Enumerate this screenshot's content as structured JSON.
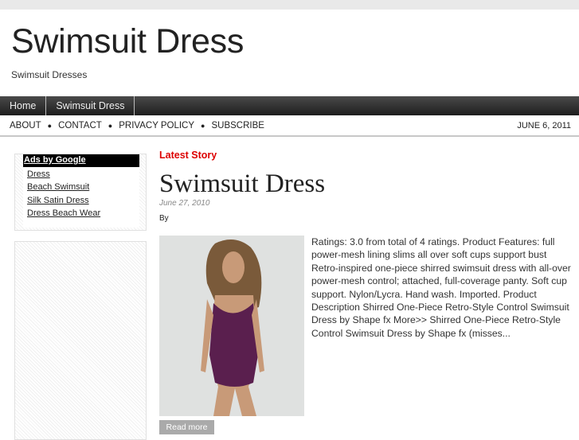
{
  "site": {
    "title": "Swimsuit Dress",
    "description": "Swimsuit Dresses"
  },
  "nav": {
    "items": [
      "Home",
      "Swimsuit Dress"
    ]
  },
  "subnav": {
    "items": [
      "ABOUT",
      "CONTACT",
      "PRIVACY POLICY",
      "SUBSCRIBE"
    ],
    "separator": "●",
    "date": "JUNE 6, 2011"
  },
  "ads": {
    "header": "Ads by Google",
    "links": [
      "Dress",
      "Beach Swimsuit",
      "Silk Satin Dress",
      "Dress Beach Wear"
    ]
  },
  "post": {
    "section": "Latest Story",
    "title": "Swimsuit Dress",
    "date": "June 27, 2010",
    "byline": "By",
    "excerpt": "Ratings: 3.0 from total of 4 ratings. Product Features: full power-mesh lining slims all over soft cups support bust Retro-inspired one-piece shirred swimsuit dress with all-over power-mesh control; attached, full-coverage panty. Soft cup support. Nylon/Lycra. Hand wash. Imported. Product Description Shirred One-Piece Retro-Style Control Swimsuit Dress by Shape fx More>> Shirred One-Piece Retro-Style Control Swimsuit Dress by Shape fx (misses...",
    "read_more": "Read more"
  }
}
